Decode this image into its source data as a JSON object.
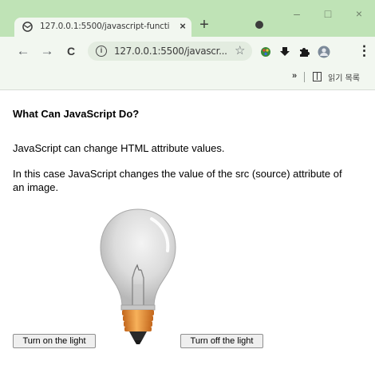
{
  "browser": {
    "tab": {
      "title": "127.0.0.1:5500/javascript-functi",
      "close_glyph": "×"
    },
    "new_tab_glyph": "+",
    "window_controls": {
      "minimize": "–",
      "maximize": "□",
      "close": "×"
    },
    "toolbar": {
      "back_glyph": "←",
      "forward_glyph": "→",
      "reload_glyph": "C",
      "url": "127.0.0.1:5500/javascr...",
      "info_glyph": "i",
      "star_glyph": "☆",
      "menu_glyph": "⋮"
    },
    "bookmarks_bar": {
      "chevron": "»",
      "reading_list_label": "읽기 목록"
    }
  },
  "page": {
    "heading": "What Can JavaScript Do?",
    "paragraph_1": "JavaScript can change HTML attribute values.",
    "paragraph_2": "In this case JavaScript changes the value of the src (source) attribute of an image.",
    "bulb_state": "off",
    "buttons": {
      "on": "Turn on the light",
      "off": "Turn off the light"
    }
  },
  "colors": {
    "tab_strip": "#bfe3b6",
    "toolbar": "#f2f7f0",
    "bulb_glass": "#d9d9d9",
    "bulb_base": "#e8923a"
  },
  "icons": [
    "globe-icon",
    "close-icon",
    "plus-icon",
    "profile-icon",
    "back-arrow-icon",
    "forward-arrow-icon",
    "reload-icon",
    "info-icon",
    "star-icon",
    "palette-icon",
    "download-icon",
    "puzzle-icon",
    "avatar-icon",
    "more-vert-icon",
    "reading-list-icon",
    "lightbulb-icon"
  ]
}
